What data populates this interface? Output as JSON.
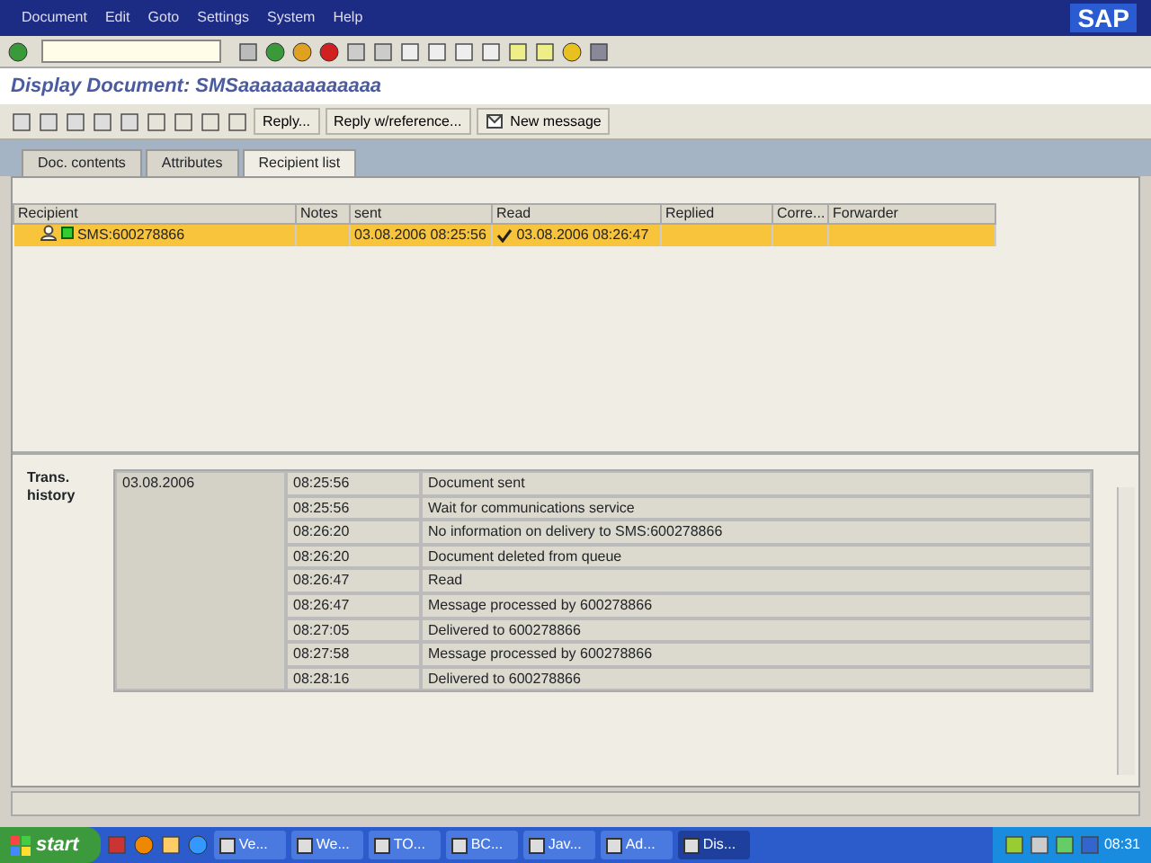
{
  "menu": [
    "Document",
    "Edit",
    "Goto",
    "Settings",
    "System",
    "Help"
  ],
  "logo": "SAP",
  "title": "Display Document: SMSaaaaaaaaaaaaa",
  "app_buttons": [
    "Reply...",
    "Reply w/reference...",
    "New message"
  ],
  "tabs": [
    {
      "label": "Doc. contents",
      "selected": false
    },
    {
      "label": "Attributes",
      "selected": false
    },
    {
      "label": "Recipient list",
      "selected": true
    }
  ],
  "table": {
    "columns": [
      "Recipient",
      "Notes",
      "sent",
      "Read",
      "Replied",
      "Corre...",
      "Forwarder"
    ],
    "rows": [
      {
        "recipient": "SMS:600278866",
        "sent": "03.08.2006 08:25:56",
        "read": "03.08.2006 08:26:47",
        "selected": true
      }
    ]
  },
  "history": {
    "label": "Trans. history",
    "date": "03.08.2006",
    "entries": [
      {
        "time": "08:25:56",
        "text": "Document sent"
      },
      {
        "time": "08:25:56",
        "text": "Wait for communications service"
      },
      {
        "time": "08:26:20",
        "text": "No information on delivery to SMS:600278866"
      },
      {
        "time": "08:26:20",
        "text": "Document deleted from queue"
      },
      {
        "time": "08:26:47",
        "text": "Read"
      },
      {
        "time": "08:26:47",
        "text": "Message processed by 600278866"
      },
      {
        "time": "08:27:05",
        "text": "Delivered to 600278866"
      },
      {
        "time": "08:27:58",
        "text": "Message processed by 600278866"
      },
      {
        "time": "08:28:16",
        "text": "Delivered to 600278866"
      }
    ]
  },
  "taskbar": {
    "start": "start",
    "tasks": [
      {
        "label": "Ve...",
        "selected": false
      },
      {
        "label": "We...",
        "selected": false
      },
      {
        "label": "TO...",
        "selected": false
      },
      {
        "label": "BC...",
        "selected": false
      },
      {
        "label": "Jav...",
        "selected": false
      },
      {
        "label": "Ad...",
        "selected": false
      },
      {
        "label": "Dis...",
        "selected": true
      }
    ],
    "clock": "08:31"
  }
}
